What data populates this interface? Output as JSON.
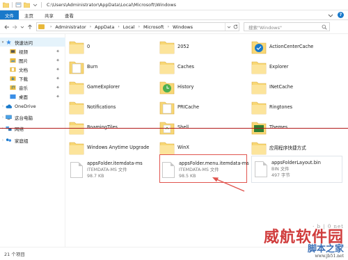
{
  "window": {
    "title": "C:\\Users\\Administrator\\AppData\\Local\\Microsoft\\Windows"
  },
  "ribbon": {
    "tabs": [
      "文件",
      "主页",
      "共享",
      "查看"
    ],
    "help_glyph": "?"
  },
  "address": {
    "crumbs": [
      "Administrator",
      "AppData",
      "Local",
      "Microsoft",
      "Windows"
    ],
    "search_placeholder": "搜索\"Windows\""
  },
  "sidebar": {
    "items": [
      {
        "label": "快速访问",
        "icon": "star-icon",
        "level": 0
      },
      {
        "label": "视频",
        "icon": "video-folder-icon",
        "level": 1
      },
      {
        "label": "图片",
        "icon": "picture-folder-icon",
        "level": 1
      },
      {
        "label": "文档",
        "icon": "document-folder-icon",
        "level": 1
      },
      {
        "label": "下载",
        "icon": "download-folder-icon",
        "level": 1
      },
      {
        "label": "音乐",
        "icon": "music-folder-icon",
        "level": 1
      },
      {
        "label": "桌面",
        "icon": "desktop-folder-icon",
        "level": 1
      },
      {
        "label": "OneDrive",
        "icon": "onedrive-cloud-icon",
        "level": 0
      },
      {
        "label": "这台电脑",
        "icon": "computer-icon",
        "level": 0
      },
      {
        "label": "网络",
        "icon": "network-icon",
        "level": 0
      },
      {
        "label": "家庭组",
        "icon": "homegroup-icon",
        "level": 0
      }
    ]
  },
  "items": [
    {
      "label": "0",
      "icon": "folder-icon"
    },
    {
      "label": "2052",
      "icon": "folder-icon"
    },
    {
      "label": "ActionCenterCache",
      "icon": "folder-blue-icon"
    },
    {
      "label": "Burn",
      "icon": "folder-doc-icon"
    },
    {
      "label": "Caches",
      "icon": "folder-icon"
    },
    {
      "label": "Explorer",
      "icon": "folder-icon"
    },
    {
      "label": "GameExplorer",
      "icon": "folder-icon"
    },
    {
      "label": "History",
      "icon": "history-folder-icon"
    },
    {
      "label": "INetCache",
      "icon": "folder-icon"
    },
    {
      "label": "Notifications",
      "icon": "folder-icon"
    },
    {
      "label": "PRICache",
      "icon": "folder-doc-icon"
    },
    {
      "label": "Ringtones",
      "icon": "folder-icon"
    },
    {
      "label": "RoamingTiles",
      "icon": "folder-icon"
    },
    {
      "label": "Shell",
      "icon": "folder-icon"
    },
    {
      "label": "Themes",
      "icon": "folder-icon"
    },
    {
      "label": "Windows Anytime Upgrade",
      "icon": "folder-icon"
    },
    {
      "label": "WinX",
      "icon": "folder-icon"
    },
    {
      "label": "应用程序快捷方式",
      "icon": "folder-icon"
    }
  ],
  "files": [
    {
      "name": "appsFolder.itemdata-ms",
      "type": "ITEMDATA-MS 文件",
      "size": "98.7 KB"
    },
    {
      "name": "appsFolder.menu.itemdata-ms",
      "type": "ITEMDATA-MS 文件",
      "size": "98.5 KB"
    },
    {
      "name": "appsFolderLayout.bin",
      "type": "BIN 文件",
      "size": "497 字节"
    }
  ],
  "status": {
    "count": "21 个项目"
  },
  "watermark": {
    "top": "· b | 0 net",
    "big": "威航软件园",
    "sub": "脚本之家",
    "url": "www.jb51.net"
  },
  "colors": {
    "accent": "#1979ca",
    "highlight": "#e0544e",
    "folder": "#f8d775"
  }
}
